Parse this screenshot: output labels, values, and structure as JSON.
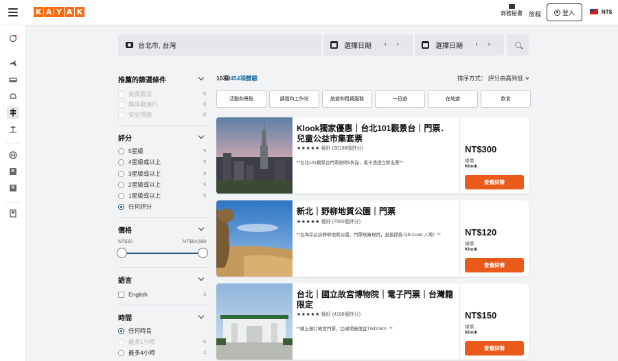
{
  "header": {
    "logo_letters": [
      "K",
      "A",
      "Y",
      "A",
      "K"
    ],
    "business_label": "商務秘書",
    "trips_label": "旅程",
    "login_label": "登入",
    "currency": "NT$"
  },
  "search": {
    "location": "台北市, 台灣",
    "date1_label": "選擇日期",
    "date2_label": "選擇日期",
    "date_arrows": "‹ ›"
  },
  "filters": {
    "recommended": {
      "title": "推薦的篩選條件",
      "items": [
        {
          "label": "免費取消",
          "count": "0"
        },
        {
          "label": "無障礙通行",
          "count": "0"
        },
        {
          "label": "安全措施",
          "count": "0"
        }
      ]
    },
    "rating": {
      "title": "評分",
      "items": [
        {
          "label": "5星級",
          "count": "9"
        },
        {
          "label": "4星級或以上",
          "count": "9"
        },
        {
          "label": "3星級或以上",
          "count": "9"
        },
        {
          "label": "2星級或以上",
          "count": "9"
        },
        {
          "label": "1星級或以上",
          "count": "9"
        },
        {
          "label": "任何評分",
          "count": ""
        }
      ]
    },
    "price": {
      "title": "價格",
      "min_label": "NT$30",
      "max_label": "NT$64,680"
    },
    "language": {
      "title": "語言",
      "items": [
        {
          "label": "English",
          "count": "3"
        }
      ]
    },
    "duration": {
      "title": "時間",
      "items": [
        {
          "label": "任何時長",
          "count": ""
        },
        {
          "label": "最多1小時",
          "count": "0"
        },
        {
          "label": "最多4小時",
          "count": "2"
        }
      ]
    }
  },
  "results": {
    "count_prefix": "10項/",
    "count_link": "454項體驗",
    "sort_label": "排序方式： 評分由高到低",
    "categories": [
      "活動和景點",
      "課程和工作坊",
      "旅遊和租賃服務",
      "一日遊",
      "在地遊",
      "飲食"
    ],
    "cards": [
      {
        "title": "Klook獨家優惠｜台北101觀景台｜門票．兒童公益市集套票",
        "stars": "★★★★★",
        "rating": "極好 (30188個評分)",
        "desc": "**台北101觀景台門票限時5折起，電子憑證立即出票**",
        "price": "NT$300",
        "total": "總價",
        "provider": "Klook",
        "button": "查看詳情"
      },
      {
        "title": "新北｜野柳地質公園｜門票",
        "stars": "★★★★★",
        "rating": "極好 (7500個評分)",
        "desc": "**北海岸必訪野柳地質公園，門票現買現用，直接掃描 QR Code 入場！**",
        "price": "NT$120",
        "total": "總價",
        "provider": "Klook",
        "button": "查看詳情"
      },
      {
        "title": "台北｜國立故宮博物院｜電子門票｜台灣籍限定",
        "stars": "★★★★★",
        "rating": "極好 (4108個評分)",
        "desc": "**線上預訂故宮門票，比現場買便宜TWD260！**",
        "price": "NT$150",
        "total": "總價",
        "provider": "Klook",
        "button": "查看詳情"
      }
    ]
  },
  "colors": {
    "brand": "#ff690f",
    "cta": "#ea5a1b",
    "link": "#1d6fa5",
    "slider": "#2a5d78"
  }
}
